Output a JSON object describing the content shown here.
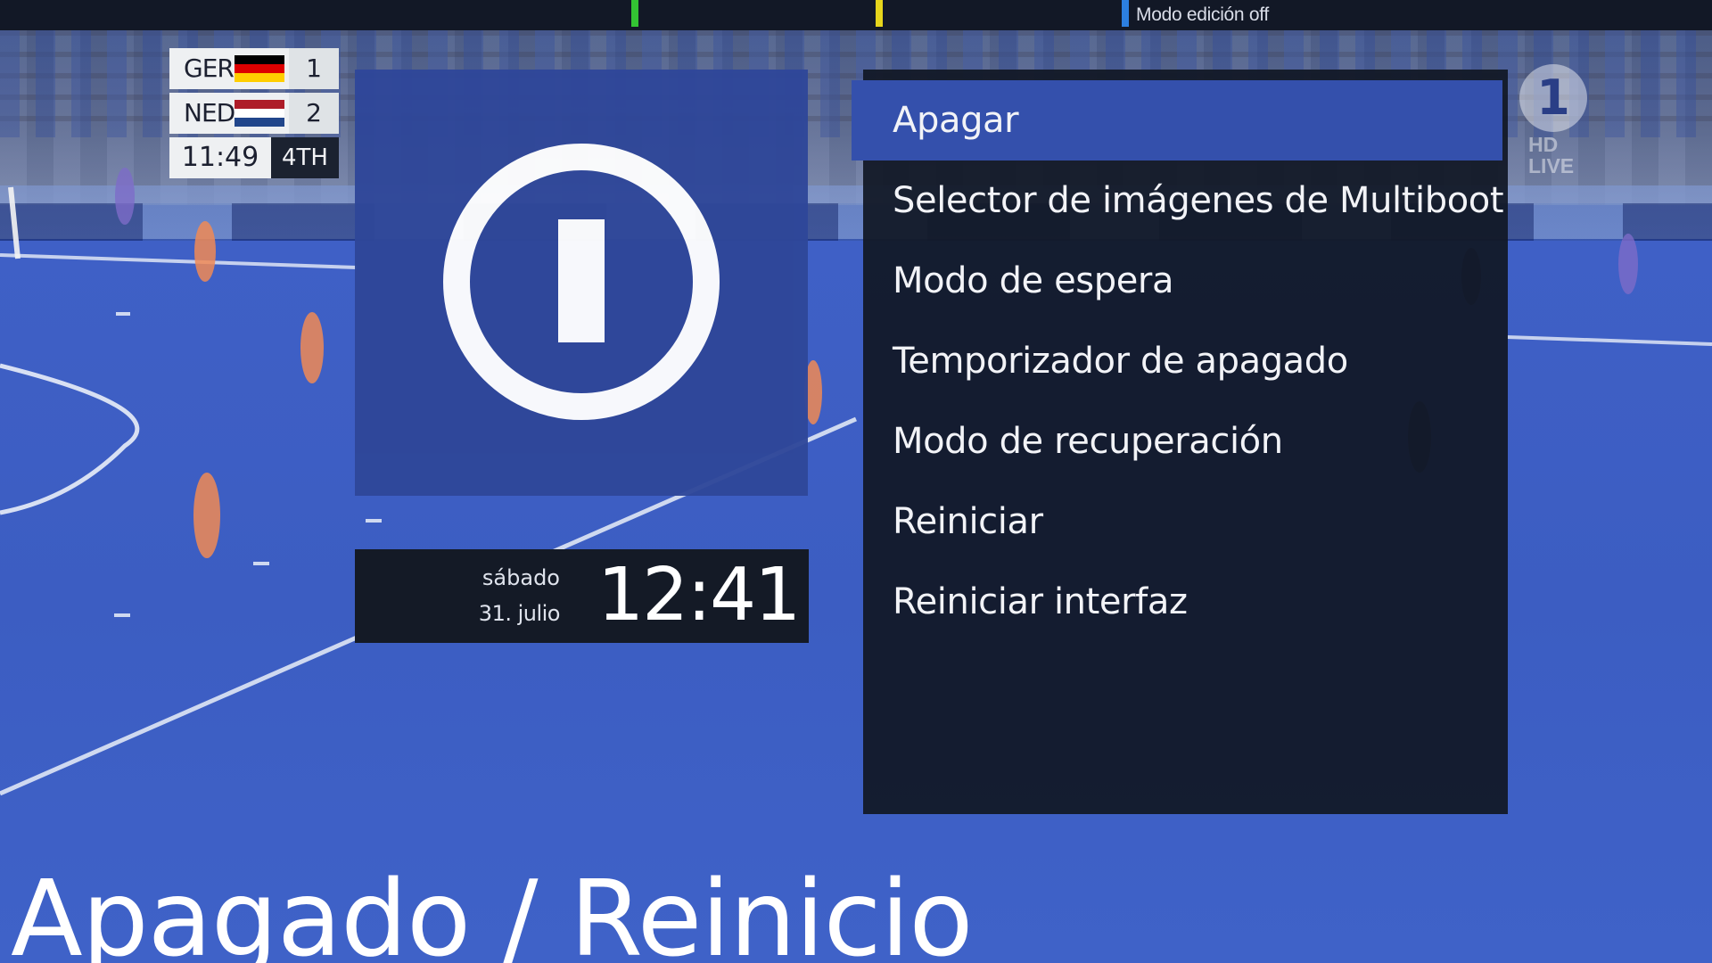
{
  "topbar": {
    "keys": [
      {
        "name": "green-key",
        "color": "#33c433"
      },
      {
        "name": "yellow-key",
        "color": "#e6d51c"
      },
      {
        "name": "blue-key",
        "color": "#2c7fe0"
      }
    ],
    "edit_mode_label": "Modo edición off"
  },
  "scoreboard": {
    "home_team": "GER",
    "home_score": "1",
    "away_team": "NED",
    "away_score": "2",
    "clock": "11:49",
    "period": "4TH"
  },
  "channel": {
    "logo": "1",
    "badge_line1": "HD",
    "badge_line2": "LIVE"
  },
  "icon_panel": {
    "icon": "power-icon",
    "color": "#2f4799"
  },
  "clock_panel": {
    "day": "sábado",
    "date": "31. julio",
    "time": "12:41"
  },
  "menu": {
    "items": [
      {
        "label": "Apagar",
        "selected": true
      },
      {
        "label": "Selector de imágenes de Multiboot",
        "selected": false
      },
      {
        "label": "Modo de espera",
        "selected": false
      },
      {
        "label": "Temporizador de apagado",
        "selected": false
      },
      {
        "label": "Modo de recuperación",
        "selected": false
      },
      {
        "label": "Reiniciar",
        "selected": false
      },
      {
        "label": "Reiniciar interfaz",
        "selected": false
      }
    ],
    "highlight_color": "#3450ac"
  },
  "screen_title": "Apagado / Reinicio"
}
